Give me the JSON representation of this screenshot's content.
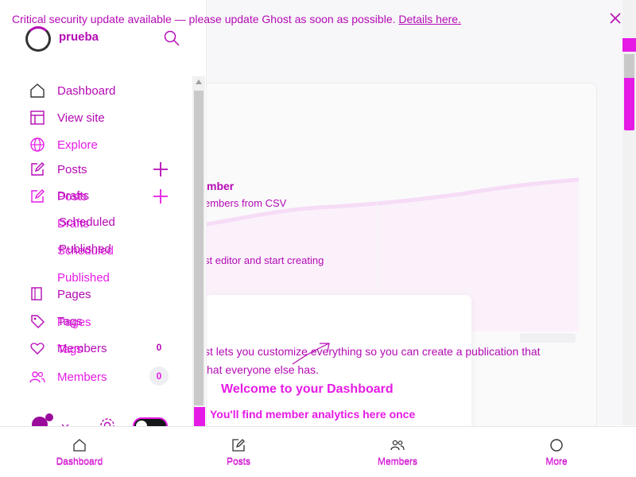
{
  "banner": {
    "message": "Critical security update available — please update Ghost as soon as possible.",
    "link": "Details here."
  },
  "sidebar": {
    "brand": "prueba",
    "items": [
      {
        "label": "Dashboard"
      },
      {
        "label": "View site"
      },
      {
        "label": "Explore"
      },
      {
        "label": "Posts"
      },
      {
        "label": "Drafts"
      },
      {
        "label": "Scheduled"
      },
      {
        "label": "Published"
      },
      {
        "label": "Pages"
      },
      {
        "label": "Tags"
      },
      {
        "label": "Members",
        "count": "0"
      }
    ],
    "ghost": {
      "posts": "Posts",
      "drafts": "Drafts",
      "scheduled": "Scheduled",
      "pages": "Pages",
      "tags": "Tags",
      "members": "Members",
      "members_count": "0"
    }
  },
  "main": {
    "line1": "mber",
    "line2": "embers from CSV",
    "line3": "st editor and start creating",
    "line4": "st lets you customize everything so you can create a publication that",
    "line5": "hat everyone else has.",
    "welcome": "Welcome to your Dashboard",
    "welcome_sub": "You'll find member analytics here once"
  },
  "tabbar": {
    "tabs": [
      {
        "label": "Dashboard"
      },
      {
        "label": "Posts"
      },
      {
        "label": "Members"
      },
      {
        "label": "More"
      }
    ]
  },
  "colors": {
    "accent": "#e61ae6",
    "accent_dark": "#b40ab4"
  }
}
